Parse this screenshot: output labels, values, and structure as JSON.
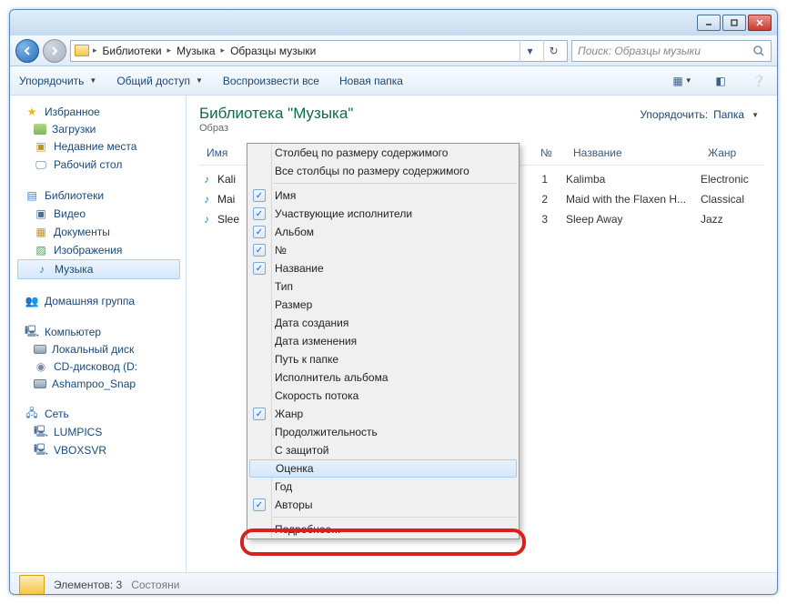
{
  "breadcrumb": {
    "root_glyph": "▸",
    "parts": [
      "Библиотеки",
      "Музыка",
      "Образцы музыки"
    ]
  },
  "search": {
    "placeholder": "Поиск: Образцы музыки"
  },
  "toolbar": {
    "organize": "Упорядочить",
    "share": "Общий доступ",
    "play_all": "Воспроизвести все",
    "new_folder": "Новая папка"
  },
  "sidebar": {
    "favorites": "Избранное",
    "downloads": "Загрузки",
    "recent": "Недавние места",
    "desktop": "Рабочий стол",
    "libraries": "Библиотеки",
    "video": "Видео",
    "documents": "Документы",
    "pictures": "Изображения",
    "music": "Музыка",
    "homegroup": "Домашняя группа",
    "computer": "Компьютер",
    "local_disk": "Локальный диск",
    "cd": "CD-дисковод (D:",
    "ashampoo": "Ashampoo_Snap",
    "network": "Сеть",
    "net1": "LUMPICS",
    "net2": "VBOXSVR"
  },
  "library": {
    "title": "Библиотека \"Музыка\"",
    "subtitle": "Образ",
    "sort_label": "Упорядочить:",
    "sort_value": "Папка"
  },
  "cols": {
    "name": "Имя",
    "num": "№",
    "title": "Название",
    "genre": "Жанр"
  },
  "rows": [
    {
      "file": "Kali",
      "num": "1",
      "title": "Kalimba",
      "genre": "Electronic"
    },
    {
      "file": "Mai",
      "num": "2",
      "title": "Maid with the Flaxen H...",
      "genre": "Classical"
    },
    {
      "file": "Slee",
      "num": "3",
      "title": "Sleep Away",
      "genre": "Jazz"
    }
  ],
  "ctx": {
    "size_col": "Столбец по размеру содержимого",
    "size_all": "Все столбцы по размеру содержимого",
    "items": [
      {
        "label": "Имя",
        "checked": true
      },
      {
        "label": "Участвующие исполнители",
        "checked": true
      },
      {
        "label": "Альбом",
        "checked": true
      },
      {
        "label": "№",
        "checked": true
      },
      {
        "label": "Название",
        "checked": true
      },
      {
        "label": "Тип",
        "checked": false
      },
      {
        "label": "Размер",
        "checked": false
      },
      {
        "label": "Дата создания",
        "checked": false
      },
      {
        "label": "Дата изменения",
        "checked": false
      },
      {
        "label": "Путь к папке",
        "checked": false
      },
      {
        "label": "Исполнитель альбома",
        "checked": false
      },
      {
        "label": "Скорость потока",
        "checked": false
      },
      {
        "label": "Жанр",
        "checked": true
      },
      {
        "label": "Продолжительность",
        "checked": false
      },
      {
        "label": "С защитой",
        "checked": false
      },
      {
        "label": "Оценка",
        "checked": false,
        "hover": true
      },
      {
        "label": "Год",
        "checked": false
      },
      {
        "label": "Авторы",
        "checked": true
      }
    ],
    "more": "Подробнее..."
  },
  "status": {
    "items_label": "Элементов: 3",
    "state": "Состояни"
  }
}
